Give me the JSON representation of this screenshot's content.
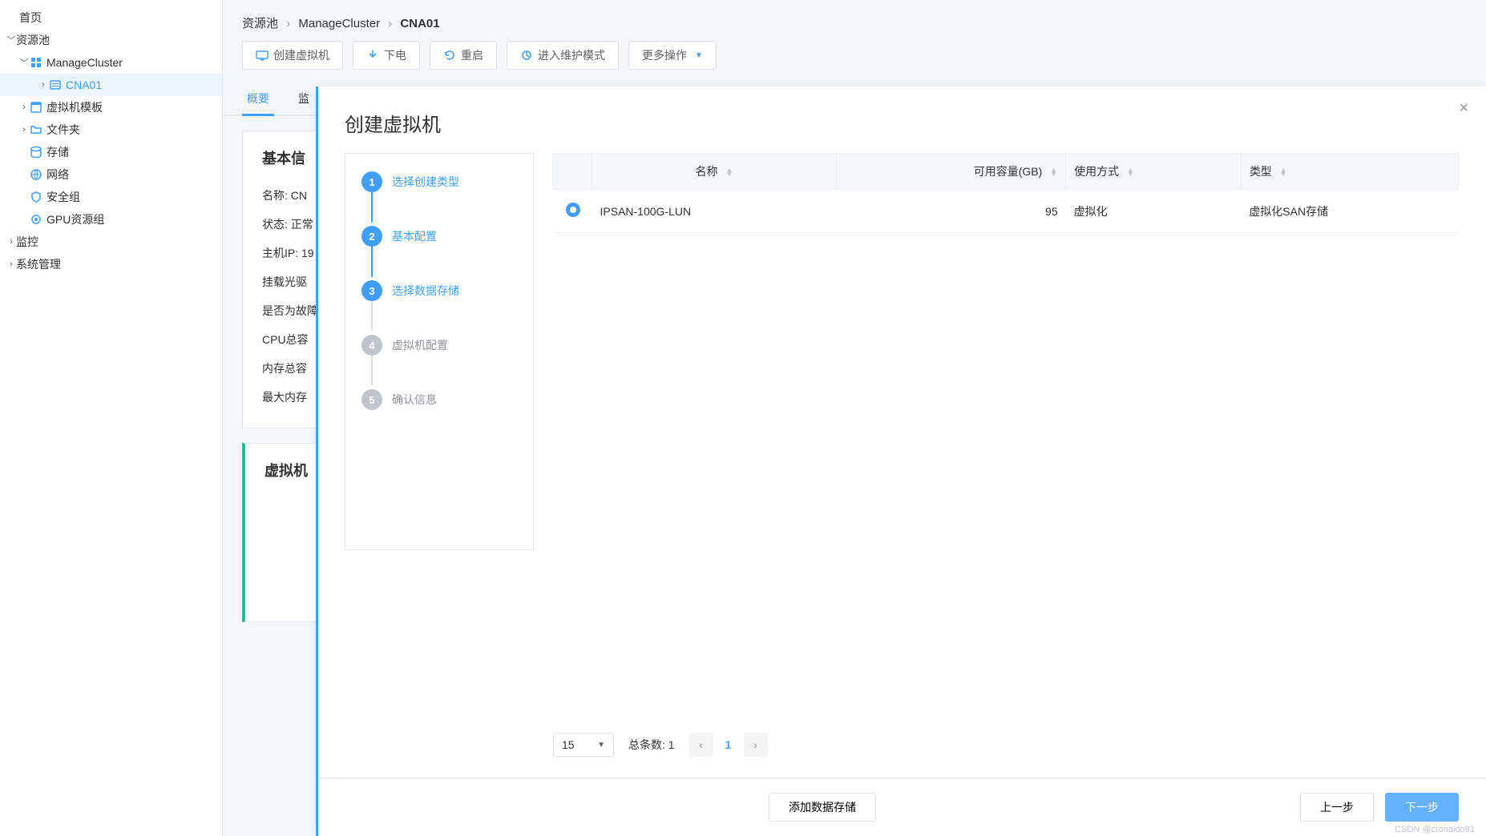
{
  "sidebar": {
    "home": "首页",
    "pool": "资源池",
    "cluster": "ManageCluster",
    "cna": "CNA01",
    "vm_template": "虚拟机模板",
    "folder": "文件夹",
    "storage": "存储",
    "network": "网络",
    "security_group": "安全组",
    "gpu_group": "GPU资源组",
    "monitor": "监控",
    "system": "系统管理"
  },
  "breadcrumb": {
    "a": "资源池",
    "b": "ManageCluster",
    "c": "CNA01"
  },
  "toolbar": {
    "create_vm": "创建虚拟机",
    "power_off": "下电",
    "reboot": "重启",
    "maintenance": "进入维护模式",
    "more": "更多操作"
  },
  "tabs": {
    "overview": "概要",
    "monitor_prefix": "监"
  },
  "panel": {
    "basic_title_prefix": "基本信",
    "name": "名称: CN",
    "status": "状态: 正常",
    "host_ip": "主机IP: 19",
    "cdrom": "挂载光驱",
    "fault": "是否为故障",
    "cpu": "CPU总容",
    "memory": "内存总容",
    "max_mem": "最大内存",
    "vm_section": "虚拟机"
  },
  "modal": {
    "title": "创建虚拟机",
    "steps": [
      {
        "num": "1",
        "label": "选择创建类型",
        "state": "done"
      },
      {
        "num": "2",
        "label": "基本配置",
        "state": "done"
      },
      {
        "num": "3",
        "label": "选择数据存储",
        "state": "active"
      },
      {
        "num": "4",
        "label": "虚拟机配置",
        "state": "pending"
      },
      {
        "num": "5",
        "label": "确认信息",
        "state": "pending"
      }
    ],
    "table": {
      "headers": {
        "name": "名称",
        "capacity": "可用容量(GB)",
        "usage": "使用方式",
        "type": "类型"
      },
      "rows": [
        {
          "name": "IPSAN-100G-LUN",
          "capacity": "95",
          "usage": "虚拟化",
          "type": "虚拟化SAN存储",
          "selected": true
        }
      ]
    },
    "pagination": {
      "page_size": "15",
      "total_label": "总条数: 1",
      "current_page": "1"
    },
    "footer": {
      "add_storage": "添加数据存储",
      "prev": "上一步",
      "next": "下一步"
    }
  },
  "watermark": "CSDN @cronaldo91"
}
